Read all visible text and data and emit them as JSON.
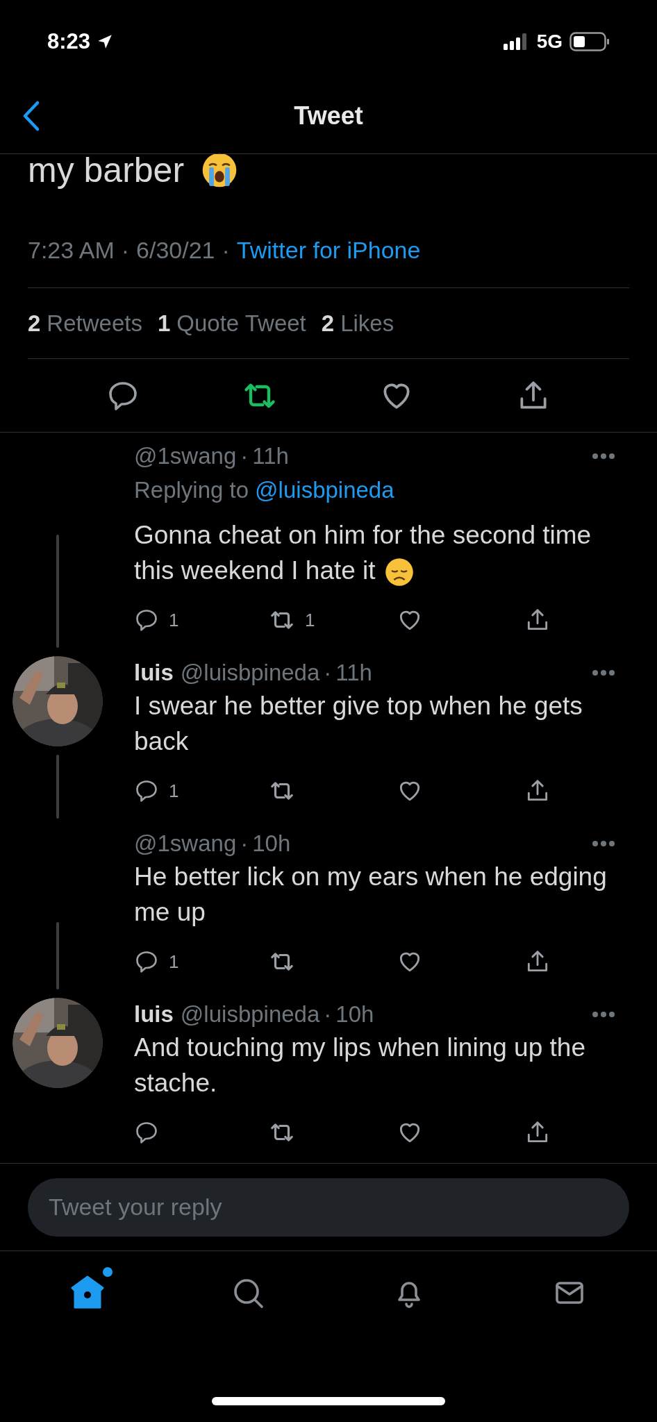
{
  "status_bar": {
    "time": "8:23",
    "network": "5G"
  },
  "header": {
    "title": "Tweet"
  },
  "tweet": {
    "text": "my barber",
    "emoji": true,
    "time": "7:23 AM",
    "dot_1": "·",
    "date": "6/30/21",
    "dot_2": "·",
    "source": "Twitter for iPhone",
    "stats": [
      {
        "count": "2",
        "label": "Retweets"
      },
      {
        "count": "1",
        "label": "Quote Tweet"
      },
      {
        "count": "2",
        "label": "Likes"
      }
    ],
    "retweeted": true
  },
  "replies": [
    {
      "handle": "@1swang",
      "dot": "·",
      "time": "11h",
      "replying_label": "Replying to",
      "replying_to": "@luisbpineda",
      "text": "Gonna cheat on him for the second time this weekend I hate it",
      "emoji": true,
      "avatar": false,
      "reply_count": "1",
      "retweet_count": "1"
    },
    {
      "name": "luis",
      "handle": "@luisbpineda",
      "dot": "·",
      "time": "11h",
      "text": "I swear he better give top when he gets back",
      "emoji": false,
      "avatar": true,
      "reply_count": "1"
    },
    {
      "handle": "@1swang",
      "dot": "·",
      "time": "10h",
      "text": "He better lick on my ears when he edging me up",
      "emoji": false,
      "avatar": false,
      "reply_count": "1"
    },
    {
      "name": "luis",
      "handle": "@luisbpineda",
      "dot": "·",
      "time": "10h",
      "text": "And touching my lips when lining up the stache.",
      "emoji": false,
      "avatar": true
    }
  ],
  "compose": {
    "placeholder": "Tweet your reply"
  },
  "tab_bar": [
    {
      "kind": "home",
      "selected": true,
      "badge": true
    },
    {
      "kind": "search",
      "selected": false,
      "badge": false
    },
    {
      "kind": "notifications",
      "selected": false,
      "badge": false
    },
    {
      "kind": "messages",
      "selected": false,
      "badge": false
    }
  ]
}
